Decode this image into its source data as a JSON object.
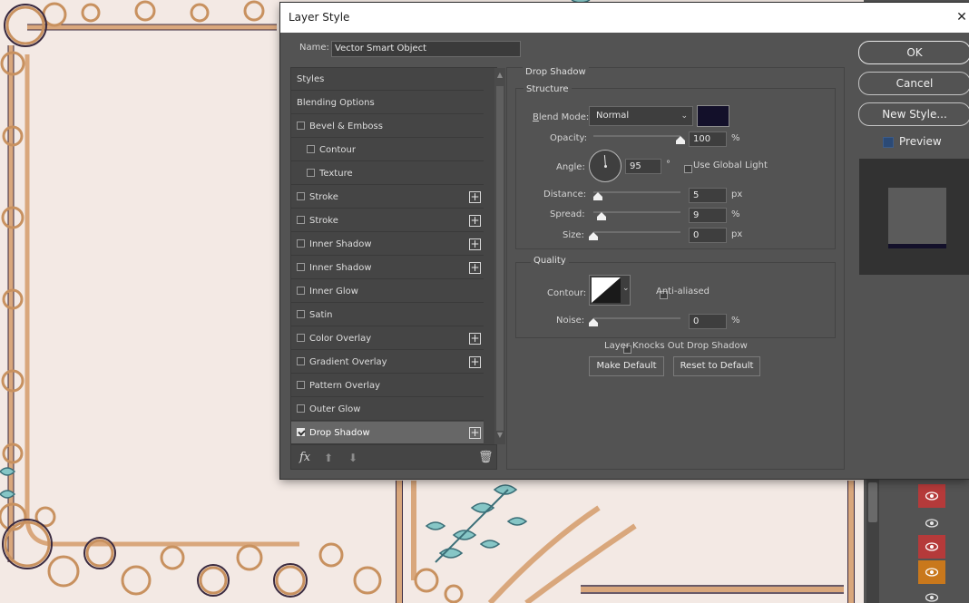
{
  "dialog": {
    "title": "Layer Style",
    "name_label": "Name:",
    "name_value": "Vector Smart Object"
  },
  "styles": {
    "items": [
      {
        "label": "Styles",
        "checkbox": false,
        "plus": false
      },
      {
        "label": "Blending Options",
        "checkbox": false,
        "plus": false
      },
      {
        "label": "Bevel & Emboss",
        "checkbox": true,
        "checked": false,
        "plus": false
      },
      {
        "label": "Contour",
        "checkbox": true,
        "checked": false,
        "plus": false,
        "indent": true
      },
      {
        "label": "Texture",
        "checkbox": true,
        "checked": false,
        "plus": false,
        "indent": true
      },
      {
        "label": "Stroke",
        "checkbox": true,
        "checked": false,
        "plus": true
      },
      {
        "label": "Stroke",
        "checkbox": true,
        "checked": false,
        "plus": true
      },
      {
        "label": "Inner Shadow",
        "checkbox": true,
        "checked": false,
        "plus": true
      },
      {
        "label": "Inner Shadow",
        "checkbox": true,
        "checked": false,
        "plus": true
      },
      {
        "label": "Inner Glow",
        "checkbox": true,
        "checked": false,
        "plus": false
      },
      {
        "label": "Satin",
        "checkbox": true,
        "checked": false,
        "plus": false
      },
      {
        "label": "Color Overlay",
        "checkbox": true,
        "checked": false,
        "plus": true
      },
      {
        "label": "Gradient Overlay",
        "checkbox": true,
        "checked": false,
        "plus": true
      },
      {
        "label": "Pattern Overlay",
        "checkbox": true,
        "checked": false,
        "plus": false
      },
      {
        "label": "Outer Glow",
        "checkbox": true,
        "checked": false,
        "plus": false
      },
      {
        "label": "Drop Shadow",
        "checkbox": true,
        "checked": true,
        "plus": true,
        "active": true
      }
    ],
    "fx_label": "fx"
  },
  "drop_shadow": {
    "section_title": "Drop Shadow",
    "structure_title": "Structure",
    "blend_mode_label": "Blend Mode:",
    "blend_mode_value": "Normal",
    "shadow_color": "#13102a",
    "opacity_label": "Opacity:",
    "opacity_value": "100",
    "opacity_unit": "%",
    "opacity_level": 1.0,
    "angle_label": "Angle:",
    "angle_value": "95",
    "angle_unit": "°",
    "use_global_light_label": "Use Global Light",
    "distance_label": "Distance:",
    "distance_value": "5",
    "distance_unit": "px",
    "distance_level": 0.05,
    "spread_label": "Spread:",
    "spread_value": "9",
    "spread_unit": "%",
    "spread_level": 0.09,
    "size_label": "Size:",
    "size_value": "0",
    "size_unit": "px",
    "size_level": 0.0,
    "quality_title": "Quality",
    "contour_label": "Contour:",
    "anti_aliased_label": "Anti-aliased",
    "noise_label": "Noise:",
    "noise_value": "0",
    "noise_unit": "%",
    "noise_level": 0.0,
    "knocks_out_label": "Layer Knocks Out Drop Shadow",
    "make_default_label": "Make Default",
    "reset_default_label": "Reset to Default"
  },
  "buttons": {
    "ok": "OK",
    "cancel": "Cancel",
    "new_style": "New Style...",
    "preview": "Preview"
  },
  "colors": {
    "dialog_bg": "#535353",
    "shadow_color": "#13102a",
    "eye_red": "#b53a3a",
    "eye_orange": "#c9781c"
  }
}
